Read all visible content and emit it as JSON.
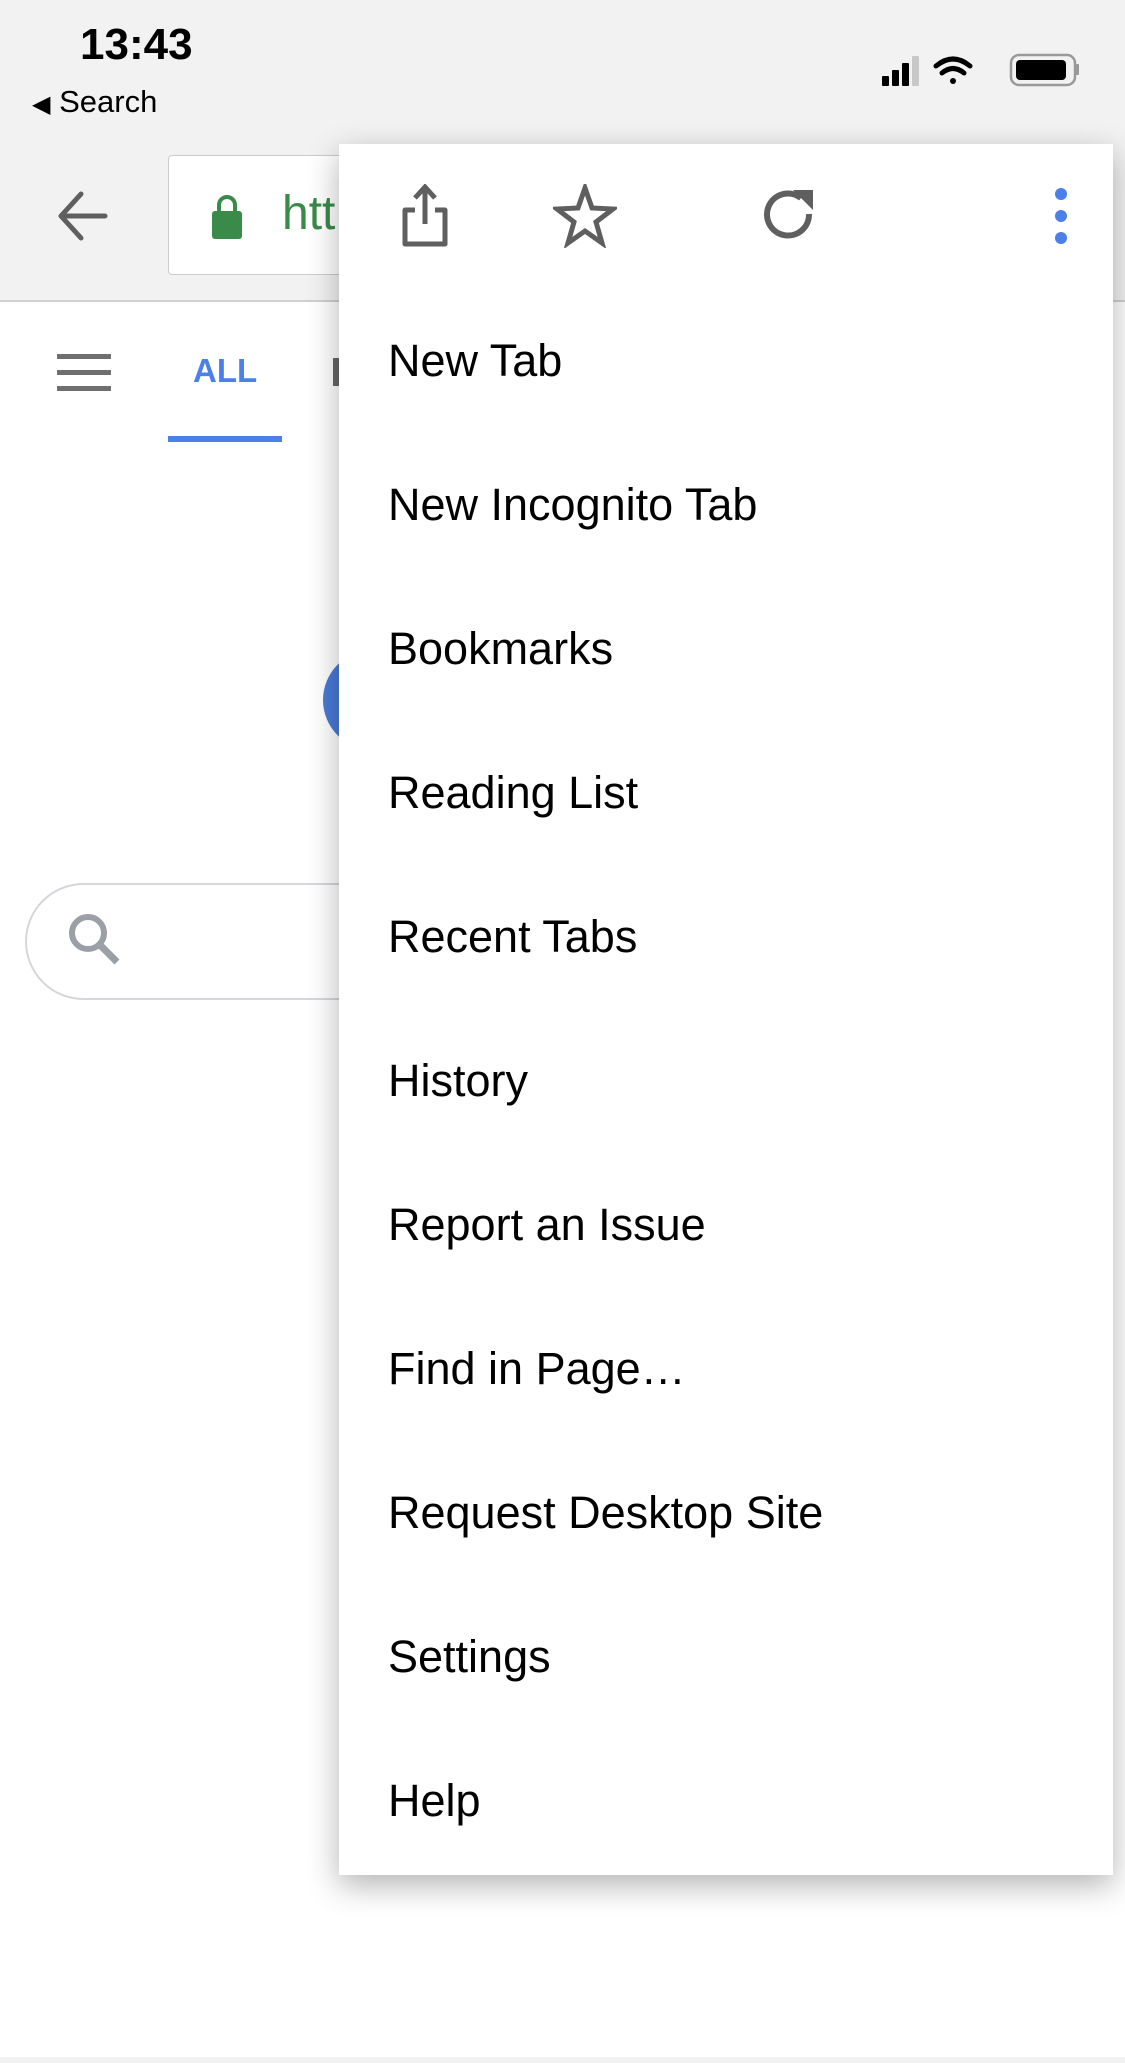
{
  "status_bar": {
    "time": "13:43",
    "back_app": "Search",
    "icons": [
      "cellular-signal-icon",
      "wifi-icon",
      "battery-icon"
    ]
  },
  "toolbar": {
    "back_icon": "arrow-left-icon",
    "url_partial": "htt",
    "lock_color": "#3a8a4a"
  },
  "page": {
    "tabs": [
      {
        "label": "ALL",
        "active": true
      }
    ],
    "accent": "#4a80e8"
  },
  "menu": {
    "top_icons": [
      "share-icon",
      "star-icon",
      "reload-icon",
      "more-vertical-icon"
    ],
    "items": [
      {
        "label": "New Tab"
      },
      {
        "label": "New Incognito Tab"
      },
      {
        "label": "Bookmarks"
      },
      {
        "label": "Reading List"
      },
      {
        "label": "Recent Tabs"
      },
      {
        "label": "History"
      },
      {
        "label": "Report an Issue"
      },
      {
        "label": "Find in Page…"
      },
      {
        "label": "Request Desktop Site"
      },
      {
        "label": "Settings"
      },
      {
        "label": "Help"
      }
    ]
  }
}
